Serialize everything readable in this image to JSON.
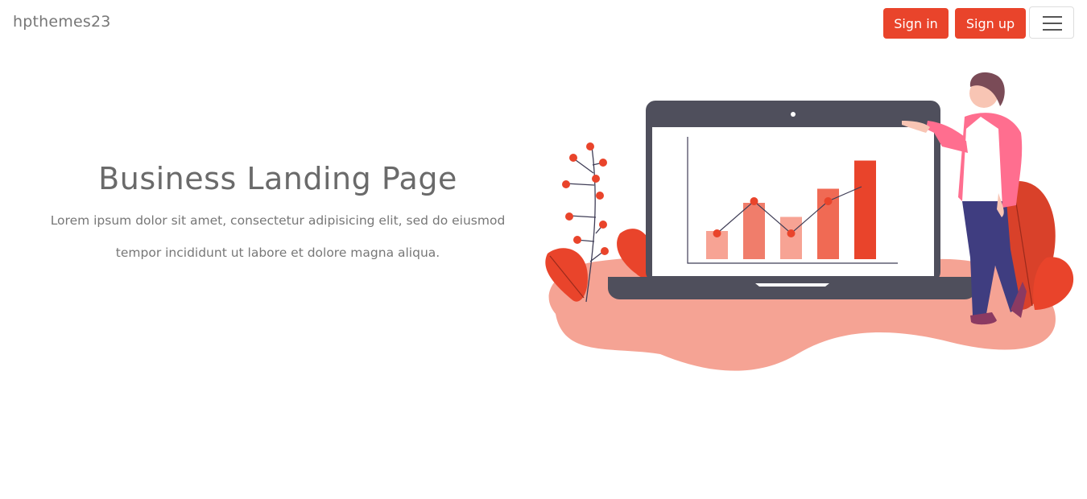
{
  "nav": {
    "brand": "hpthemes23",
    "sign_in_label": "Sign in",
    "sign_up_label": "Sign up",
    "menu_icon": "hamburger-menu-icon"
  },
  "hero": {
    "title": "Business Landing Page",
    "subtitle_line1": "Lorem ipsum dolor sit amet, consectetur adipisicing elit, sed do eiusmod",
    "subtitle_line2": "tempor incididunt ut labore et dolore magna aliqua."
  },
  "illustration": {
    "name": "business-analytics-illustration",
    "chart_bar_values": [
      2,
      4,
      3,
      5,
      7
    ],
    "chart_line_values": [
      3,
      5,
      3,
      5,
      6
    ]
  },
  "colors": {
    "accent": "#e9442b",
    "blob": "#f5a394",
    "laptop": "#4f4f5c"
  }
}
